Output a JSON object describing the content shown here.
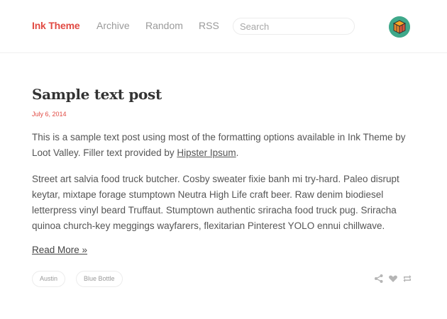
{
  "header": {
    "brand": "Ink Theme",
    "nav": [
      "Archive",
      "Random",
      "RSS"
    ],
    "search_placeholder": "Search",
    "avatar_icon": "cube-icon"
  },
  "post": {
    "title": "Sample text post",
    "date": "July 6, 2014",
    "para1_before": "This is a sample text post using most of the formatting options available in Ink Theme by Loot Valley. Filler text provided by ",
    "para1_link": "Hipster Ipsum",
    "para1_after": ".",
    "para2": "Street art salvia food truck butcher. Cosby sweater fixie banh mi try-hard. Paleo disrupt keytar, mixtape forage stumptown Neutra High Life craft beer. Raw denim biodiesel letterpress vinyl beard Truffaut. Stumptown authentic sriracha food truck pug. Sriracha quinoa church-key meggings wayfarers, flexitarian Pinterest YOLO ennui chillwave.",
    "read_more": "Read More »",
    "tags": [
      "Austin",
      "Blue Bottle"
    ],
    "actions": [
      "share-icon",
      "heart-icon",
      "reblog-icon"
    ]
  },
  "colors": {
    "accent": "#e14a43",
    "text": "#555555",
    "muted": "#9a9a9a",
    "avatar_bg": "#3fa88a"
  }
}
